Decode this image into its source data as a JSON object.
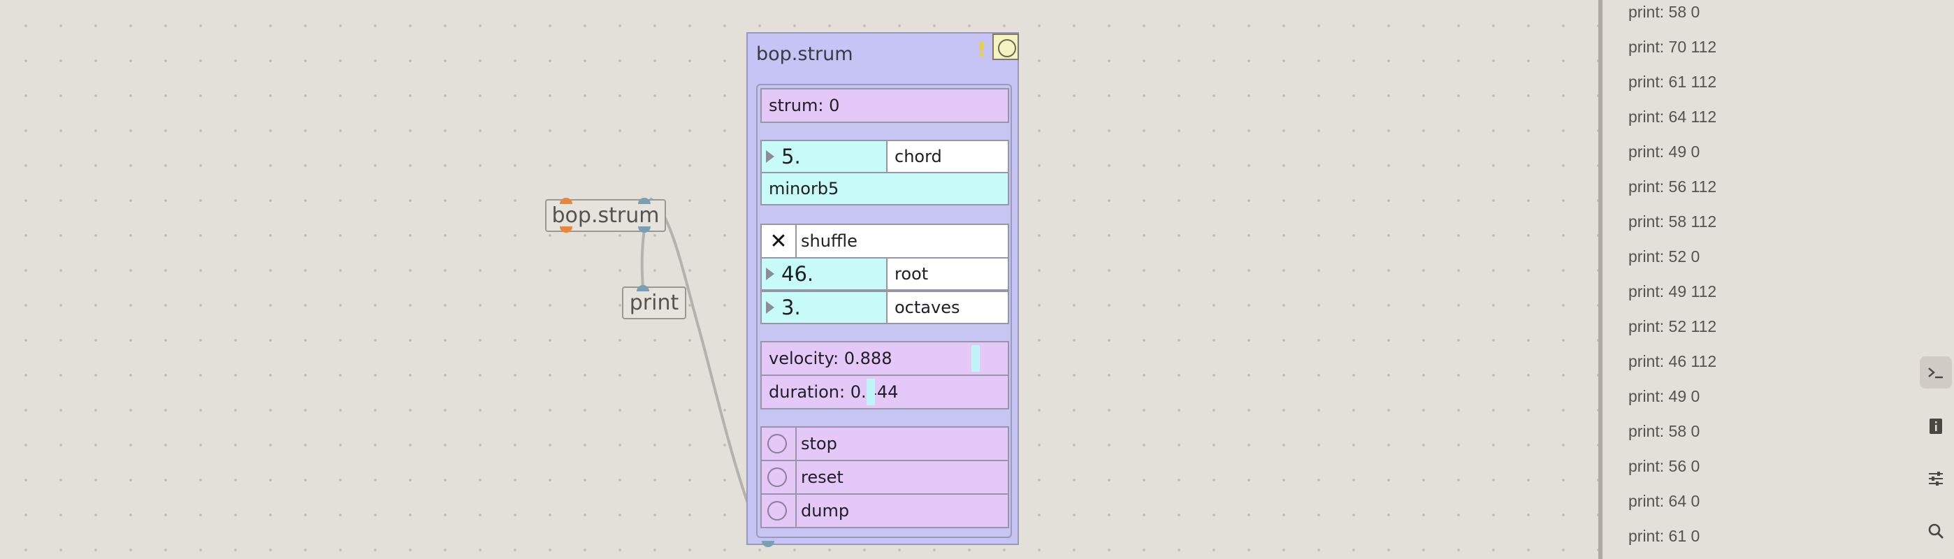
{
  "patcher": {
    "obj_bop_strum": "bop.strum",
    "obj_print": "print"
  },
  "bpatcher": {
    "title": "bop.strum",
    "warning": "!",
    "strum_label": "strum: 0",
    "chord_value": "5.",
    "chord_label": "chord",
    "chord_name": "minorb5",
    "shuffle_label": "shuffle",
    "shuffle_checked_glyph": "✕",
    "root_value": "46.",
    "root_label": "root",
    "octaves_value": "3.",
    "octaves_label": "octaves",
    "velocity_label": "velocity: 0.888",
    "velocity_level": 0.888,
    "duration_label": "duration: 0.444",
    "duration_level": 0.444,
    "stop_label": "stop",
    "reset_label": "reset",
    "dump_label": "dump"
  },
  "console": {
    "lines": [
      "print: 58 0",
      "print: 70 112",
      "print: 61 112",
      "print: 64 112",
      "print: 49 0",
      "print: 56 112",
      "print: 58 112",
      "print: 52 0",
      "print: 49 112",
      "print: 52 112",
      "print: 46 112",
      "print: 49 0",
      "print: 58 0",
      "print: 56 0",
      "print: 64 0",
      "print: 61 0"
    ]
  },
  "right_toolbar": {
    "icons": [
      "console-icon",
      "info-icon",
      "sliders-icon",
      "search-icon"
    ]
  }
}
